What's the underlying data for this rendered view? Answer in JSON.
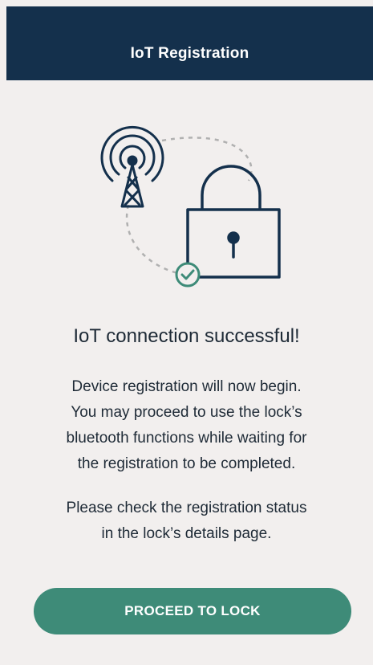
{
  "header": {
    "title": "IoT Registration"
  },
  "illustration": {
    "icons": [
      "antenna-tower-icon",
      "padlock-icon",
      "check-circle-icon"
    ],
    "colors": {
      "stroke": "#14304c",
      "accent": "#3e8b78",
      "dash": "#b0b0b0"
    }
  },
  "main": {
    "heading": "IoT connection successful!",
    "message_lines": [
      "Device registration will now begin.",
      "You may proceed to use the lock’s",
      "bluetooth functions while waiting for",
      "the registration to be completed."
    ],
    "status_lines": [
      "Please check the registration status",
      "in the lock’s details page."
    ]
  },
  "actions": {
    "proceed_label": "PROCEED TO LOCK"
  },
  "colors": {
    "header_bg": "#14304c",
    "page_bg": "#f2efee",
    "button_bg": "#3e8b78"
  }
}
